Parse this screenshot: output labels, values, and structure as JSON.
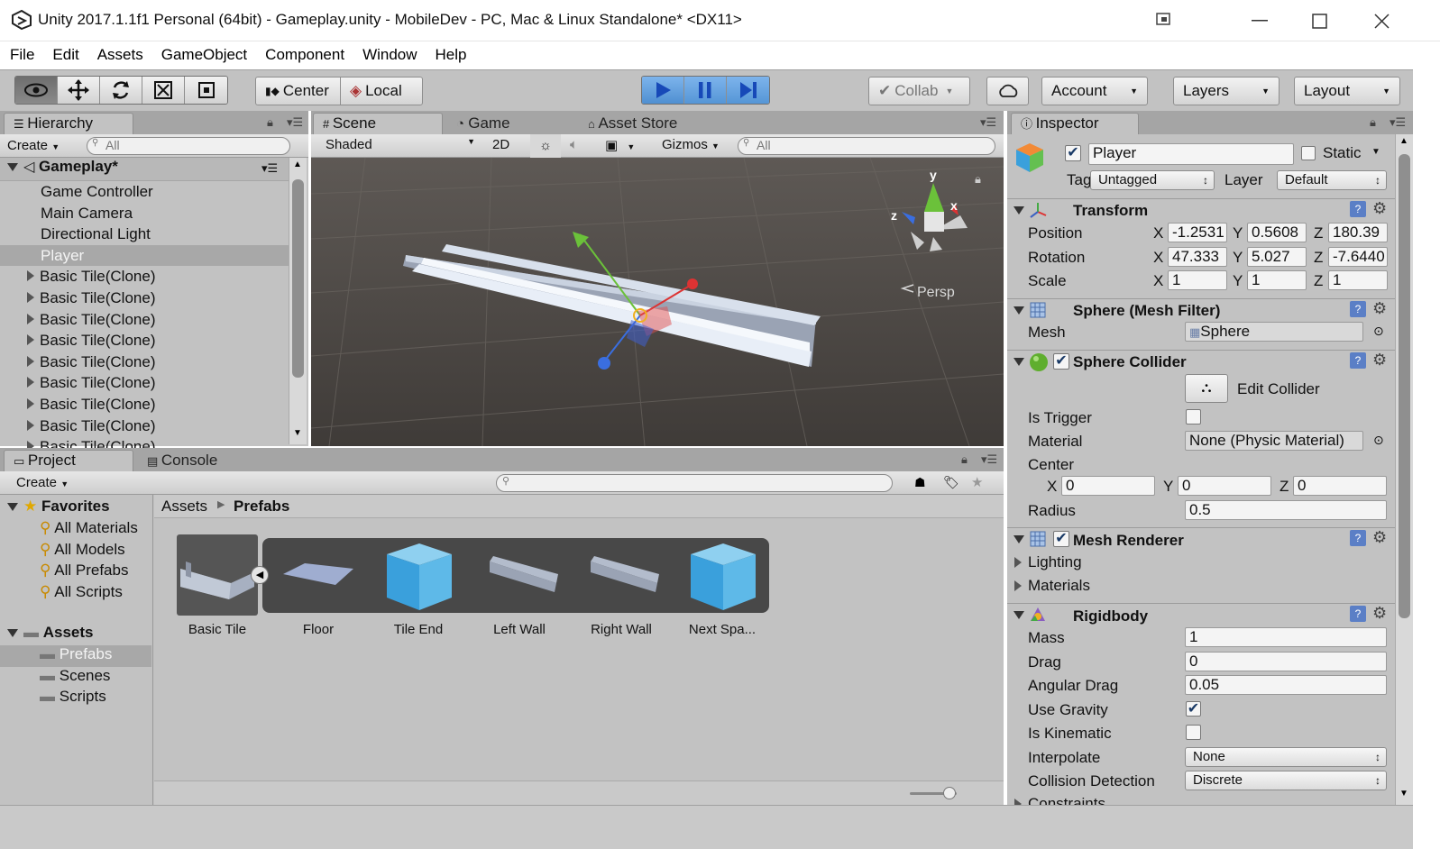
{
  "window": {
    "title": "Unity 2017.1.1f1 Personal (64bit) - Gameplay.unity - MobileDev - PC, Mac & Linux Standalone* <DX11>"
  },
  "menu": [
    "File",
    "Edit",
    "Assets",
    "GameObject",
    "Component",
    "Window",
    "Help"
  ],
  "toolbar": {
    "pivot": "Center",
    "space": "Local",
    "collab": "Collab",
    "account": "Account",
    "layers": "Layers",
    "layout": "Layout"
  },
  "hierarchy": {
    "tab": "Hierarchy",
    "create": "Create",
    "search": "All",
    "scene": "Gameplay*",
    "items": [
      "Game Controller",
      "Main Camera",
      "Directional Light",
      "Player",
      "Basic Tile(Clone)",
      "Basic Tile(Clone)",
      "Basic Tile(Clone)",
      "Basic Tile(Clone)",
      "Basic Tile(Clone)",
      "Basic Tile(Clone)",
      "Basic Tile(Clone)",
      "Basic Tile(Clone)",
      "Basic Tile(Clone)"
    ]
  },
  "scene": {
    "tabs": [
      "Scene",
      "Game",
      "Asset Store"
    ],
    "shading": "Shaded",
    "mode2d": "2D",
    "gizmos": "Gizmos",
    "search": "All",
    "persp": "Persp",
    "axes": {
      "x": "x",
      "y": "y",
      "z": "z"
    }
  },
  "project": {
    "tabs": [
      "Project",
      "Console"
    ],
    "create": "Create",
    "favorites_label": "Favorites",
    "favorites": [
      "All Materials",
      "All Models",
      "All Prefabs",
      "All Scripts"
    ],
    "assets_label": "Assets",
    "folders": [
      "Prefabs",
      "Scenes",
      "Scripts"
    ],
    "breadcrumb": [
      "Assets",
      "Prefabs"
    ],
    "items": [
      "Basic Tile",
      "Floor",
      "Tile End",
      "Left Wall",
      "Right Wall",
      "Next Spa..."
    ]
  },
  "inspector": {
    "tab": "Inspector",
    "name": "Player",
    "static": "Static",
    "tag_label": "Tag",
    "tag": "Untagged",
    "layer_label": "Layer",
    "layer": "Default",
    "transform": {
      "title": "Transform",
      "position_label": "Position",
      "rotation_label": "Rotation",
      "scale_label": "Scale",
      "position": [
        "-1.2531",
        "0.5608",
        "180.39"
      ],
      "rotation": [
        "47.333",
        "5.027",
        "-7.6440"
      ],
      "scale": [
        "1",
        "1",
        "1"
      ]
    },
    "axis": [
      "X",
      "Y",
      "Z"
    ],
    "mesh_filter": {
      "title": "Sphere (Mesh Filter)",
      "mesh_label": "Mesh",
      "mesh": "Sphere"
    },
    "collider": {
      "title": "Sphere Collider",
      "edit": "Edit Collider",
      "is_trigger": "Is Trigger",
      "material_label": "Material",
      "material": "None (Physic Material)",
      "center_label": "Center",
      "center": [
        "0",
        "0",
        "0"
      ],
      "radius_label": "Radius",
      "radius": "0.5"
    },
    "renderer": {
      "title": "Mesh Renderer",
      "lighting": "Lighting",
      "materials": "Materials"
    },
    "rigidbody": {
      "title": "Rigidbody",
      "mass_label": "Mass",
      "mass": "1",
      "drag_label": "Drag",
      "drag": "0",
      "angular_label": "Angular Drag",
      "angular": "0.05",
      "gravity_label": "Use Gravity",
      "kinematic_label": "Is Kinematic",
      "interp_label": "Interpolate",
      "interp": "None",
      "collision_label": "Collision Detection",
      "collision": "Discrete",
      "constraints": "Constraints"
    }
  },
  "colors": {
    "accent": "#3d6fb6",
    "panel": "#c2c2c2",
    "scene_bg": "#4f4a46"
  }
}
